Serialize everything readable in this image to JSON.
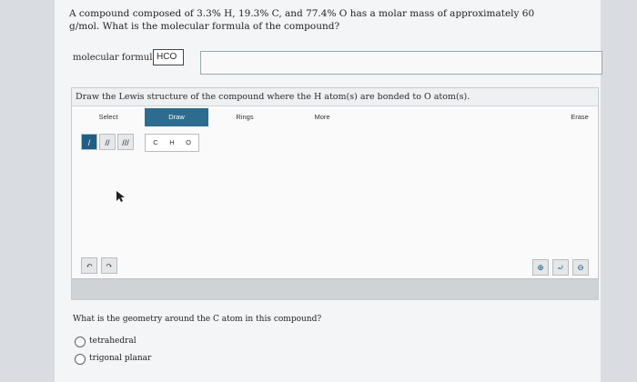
{
  "question": {
    "text": "A compound composed of 3.3% H, 19.3% C, and 77.4% O has a molar mass of approximately 60 g/mol. What is the molecular formula of the compound?"
  },
  "formula": {
    "label": "molecular formula:",
    "value": "HCO"
  },
  "drawing": {
    "prompt": "Draw the Lewis structure of the compound where the H atom(s) are bonded to O atom(s).",
    "toolbar": {
      "select": "Select",
      "draw": "Draw",
      "rings": "Rings",
      "more": "More",
      "erase": "Erase"
    },
    "bonds": [
      "/",
      "//",
      "///"
    ],
    "atoms": [
      "C",
      "H",
      "O"
    ]
  },
  "geometry": {
    "question": "What is the geometry around the C atom in this compound?",
    "options": [
      "tetrahedral",
      "trigonal planar"
    ]
  }
}
